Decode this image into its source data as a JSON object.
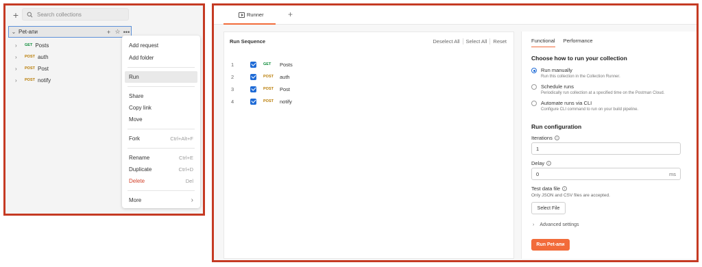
{
  "sidebar": {
    "search_placeholder": "Search collections",
    "collection_name": "Pet-апи",
    "requests": [
      {
        "method": "GET",
        "name": "Posts"
      },
      {
        "method": "POST",
        "name": "auth"
      },
      {
        "method": "POST",
        "name": "Post"
      },
      {
        "method": "POST",
        "name": "notify"
      }
    ]
  },
  "context_menu": {
    "add_request": "Add request",
    "add_folder": "Add folder",
    "run": "Run",
    "share": "Share",
    "copy_link": "Copy link",
    "move": "Move",
    "fork": "Fork",
    "fork_shortcut": "Ctrl+Alt+F",
    "rename": "Rename",
    "rename_shortcut": "Ctrl+E",
    "duplicate": "Duplicate",
    "duplicate_shortcut": "Ctrl+D",
    "delete": "Delete",
    "delete_shortcut": "Del",
    "more": "More"
  },
  "runner": {
    "tab_label": "Runner",
    "sequence": {
      "title": "Run Sequence",
      "deselect_all": "Deselect All",
      "select_all": "Select All",
      "reset": "Reset",
      "items": [
        {
          "num": "1",
          "method": "GET",
          "name": "Posts"
        },
        {
          "num": "2",
          "method": "POST",
          "name": "auth"
        },
        {
          "num": "3",
          "method": "POST",
          "name": "Post"
        },
        {
          "num": "4",
          "method": "POST",
          "name": "notify"
        }
      ]
    },
    "config": {
      "tab_functional": "Functional",
      "tab_performance": "Performance",
      "how_heading": "Choose how to run your collection",
      "options": [
        {
          "title": "Run manually",
          "desc": "Run this collection in the Collection Runner."
        },
        {
          "title": "Schedule runs",
          "desc": "Periodically run collection at a specified time on the Postman Cloud."
        },
        {
          "title": "Automate runs via CLI",
          "desc": "Configure CLI command to run on your build pipeline."
        }
      ],
      "run_config_heading": "Run configuration",
      "iterations_label": "Iterations",
      "iterations_value": "1",
      "delay_label": "Delay",
      "delay_value": "0",
      "delay_unit": "ms",
      "test_data_label": "Test data file",
      "test_data_hint": "Only JSON and CSV files are accepted.",
      "select_file": "Select File",
      "advanced_settings": "Advanced settings",
      "run_button": "Run Pet-апи"
    }
  },
  "colors": {
    "accent": "#f26b3a",
    "checkbox": "#1f6bd6",
    "get_method": "#0b8a37",
    "post_method": "#b87a00",
    "frame_highlight": "#c53a23"
  }
}
